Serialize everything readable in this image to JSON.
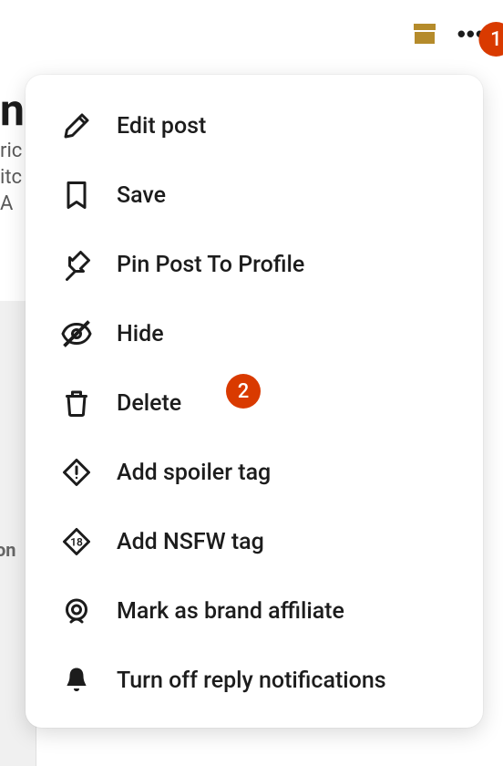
{
  "background": {
    "title_fragment": "n",
    "text_lines": [
      "ric",
      "itc",
      "A"
    ],
    "om_text": "on"
  },
  "header": {
    "badge1": "1"
  },
  "menu": {
    "items": [
      {
        "label": "Edit post"
      },
      {
        "label": "Save"
      },
      {
        "label": "Pin Post To Profile"
      },
      {
        "label": "Hide"
      },
      {
        "label": "Delete",
        "badge": "2"
      },
      {
        "label": "Add spoiler tag"
      },
      {
        "label": "Add NSFW tag"
      },
      {
        "label": "Mark as brand affiliate"
      },
      {
        "label": "Turn off reply notifications"
      }
    ]
  }
}
